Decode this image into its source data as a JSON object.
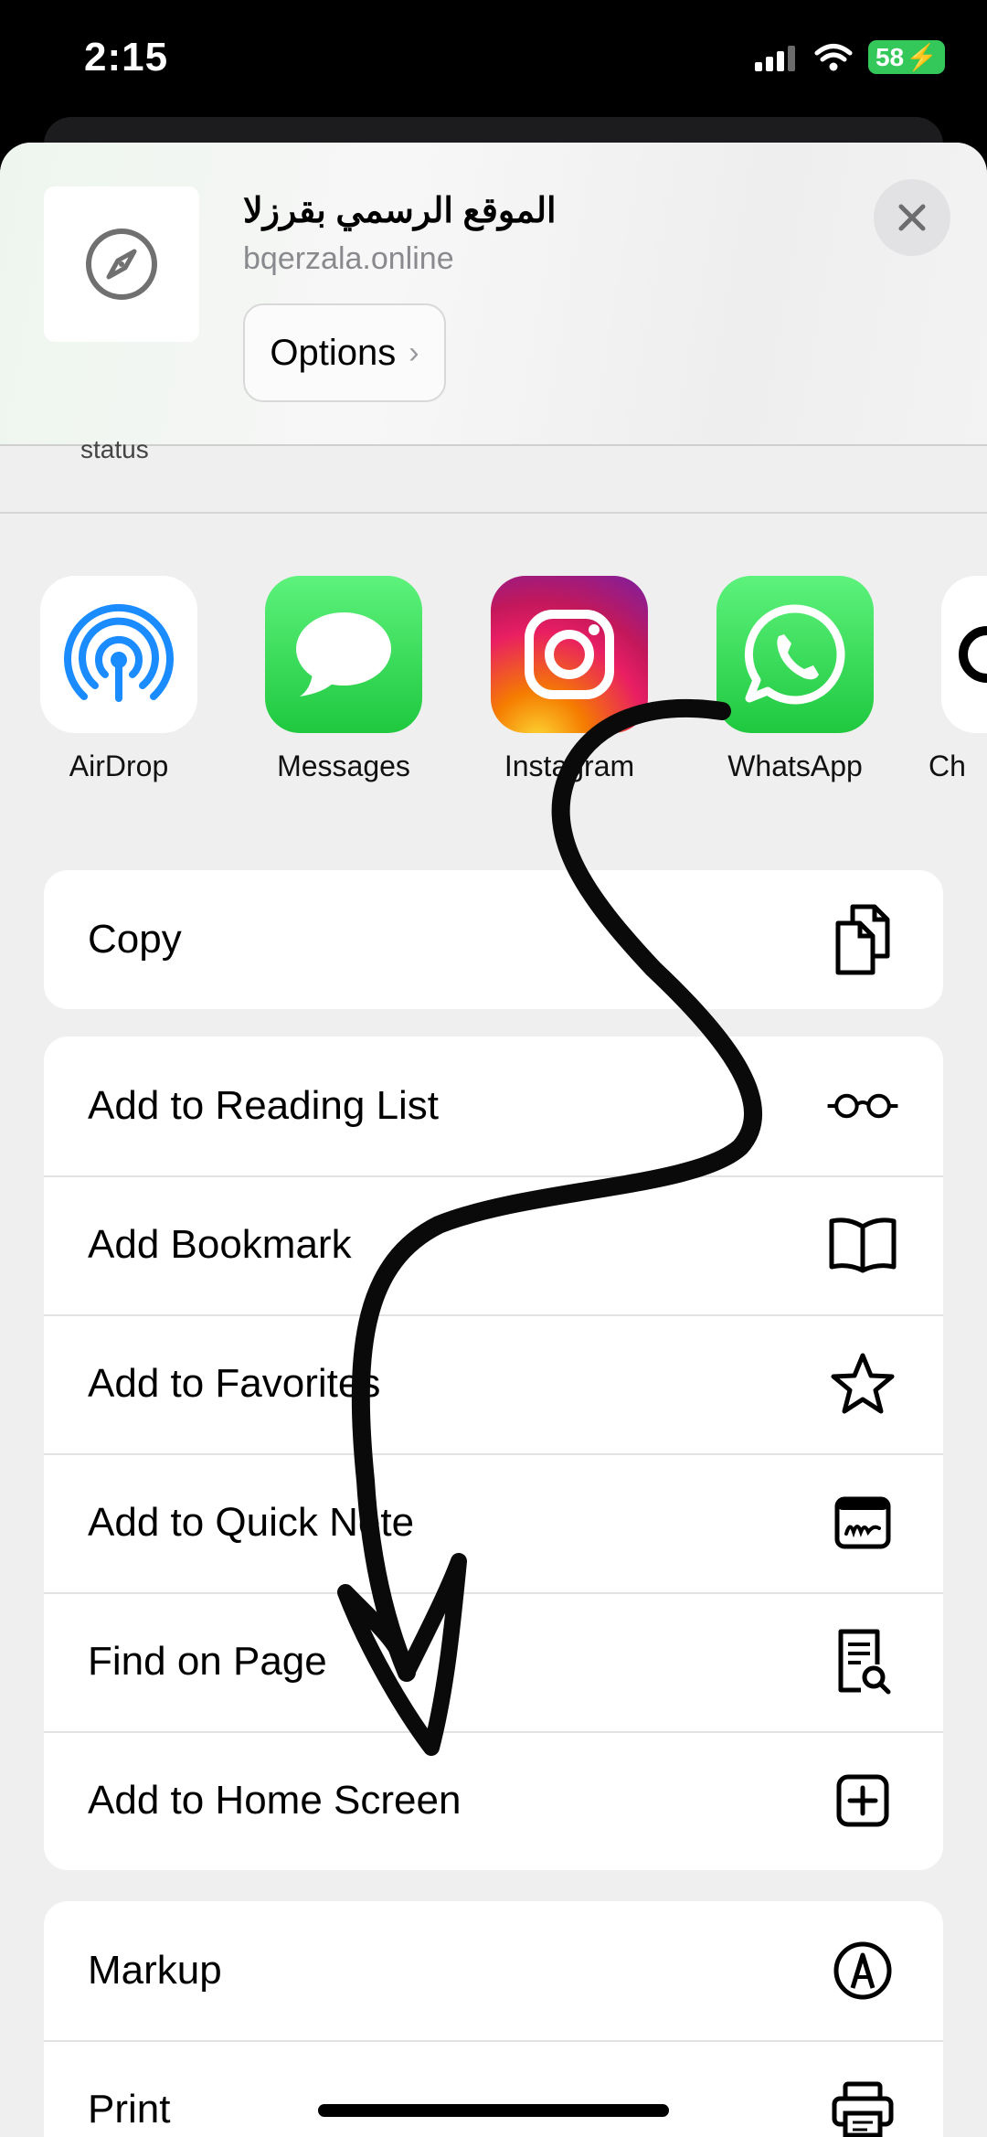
{
  "status_bar": {
    "time": "2:15",
    "battery": "58"
  },
  "header": {
    "site_title": "الموقع الرسمي بقرزلا",
    "site_url": "bqerzala.online",
    "options_label": "Options",
    "status_peek": "status",
    "icons": {
      "site": "compass-icon",
      "close": "close-icon",
      "options": "chevron-right-icon"
    }
  },
  "apps": [
    {
      "label": "AirDrop",
      "icon": "airdrop-icon"
    },
    {
      "label": "Messages",
      "icon": "messages-icon"
    },
    {
      "label": "Instagram",
      "icon": "instagram-icon"
    },
    {
      "label": "WhatsApp",
      "icon": "whatsapp-icon"
    },
    {
      "label": "Ch",
      "icon": "chatgpt-icon"
    }
  ],
  "actions": {
    "copy": {
      "label": "Copy",
      "icon": "copy-icon"
    },
    "group2": [
      {
        "label": "Add to Reading List",
        "icon": "glasses-icon"
      },
      {
        "label": "Add Bookmark",
        "icon": "book-icon"
      },
      {
        "label": "Add to Favorites",
        "icon": "star-icon"
      },
      {
        "label": "Add to Quick Note",
        "icon": "quick-note-icon"
      },
      {
        "label": "Find on Page",
        "icon": "find-doc-icon"
      },
      {
        "label": "Add to Home Screen",
        "icon": "plus-square-icon"
      }
    ],
    "group3": [
      {
        "label": "Markup",
        "icon": "markup-pen-icon"
      },
      {
        "label": "Print",
        "icon": "printer-icon"
      }
    ]
  },
  "colors": {
    "whatsapp_green": "#25d366",
    "battery_green": "#34c759",
    "airdrop_blue": "#1a8cff"
  }
}
